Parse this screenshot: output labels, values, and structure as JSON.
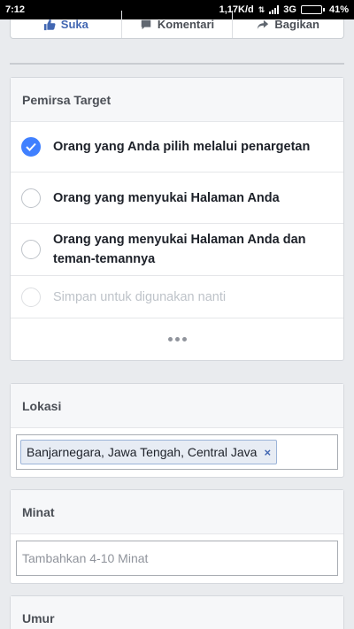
{
  "status_bar": {
    "time": "7:12",
    "data_speed": "1,17K/d",
    "network": "3G",
    "battery": "41%",
    "battery_level": 0.41
  },
  "action_bar": {
    "like_label": "Suka",
    "comment_label": "Komentari",
    "share_label": "Bagikan"
  },
  "audience": {
    "title": "Pemirsa Target",
    "options": [
      {
        "label": "Orang yang Anda pilih melalui penargetan"
      },
      {
        "label": "Orang yang menyukai Halaman Anda"
      },
      {
        "label": "Orang yang menyukai Halaman Anda dan teman-temannya"
      },
      {
        "label": "Simpan untuk digunakan nanti"
      }
    ]
  },
  "location": {
    "title": "Lokasi",
    "tag": "Banjarnegara, Jawa Tengah, Central Java",
    "remove_symbol": "×"
  },
  "interests": {
    "title": "Minat",
    "placeholder": "Tambahkan 4-10 Minat"
  },
  "age": {
    "title": "Umur"
  },
  "colors": {
    "accent": "#4080ff",
    "brand": "#4267b2",
    "background": "#e9ebee"
  }
}
